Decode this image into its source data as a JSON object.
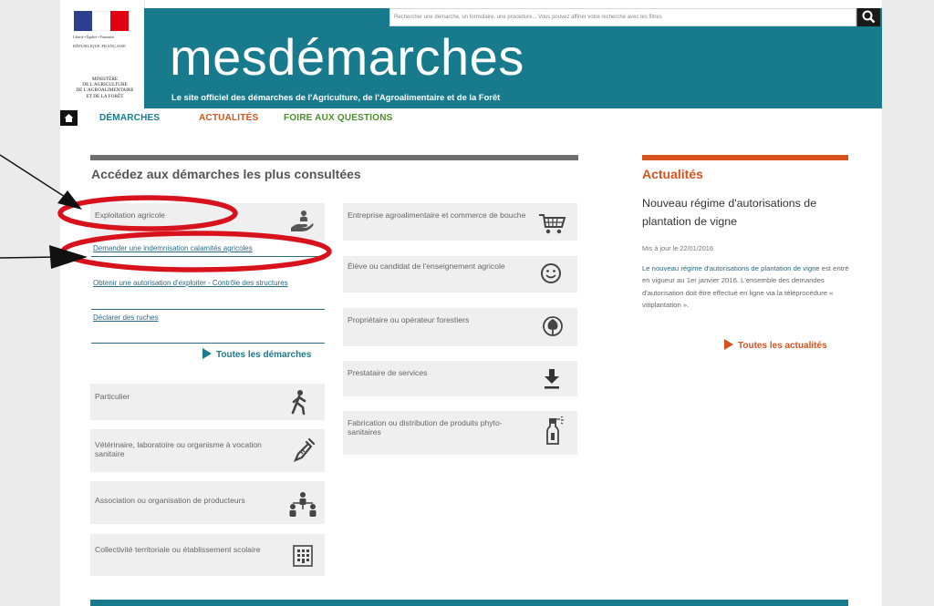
{
  "header": {
    "motto": "Liberté • Égalité • Fraternité",
    "republic": "RÉPUBLIQUE FRANÇAISE",
    "ministry_lines": [
      "MINISTÈRE",
      "DE L'AGRICULTURE",
      "DE L'AGROALIMENTAIRE",
      "ET DE LA FORÊT"
    ],
    "search_placeholder": "Rechercher une démarche, un formulaire, une procédure... Vous pouvez affiner votre recherche avec les filtres",
    "site_title": "mesdémarches",
    "site_subtitle": "Le site officiel des démarches de l'Agriculture, de l'Agroalimentaire et de la Forêt",
    "banner_color": "#187b8d"
  },
  "nav": {
    "demarches": "DÉMARCHES",
    "actualites": "ACTUALITÉS",
    "faq": "FOIRE AUX QUESTIONS"
  },
  "main": {
    "section_title": "Accédez aux démarches les plus consultées",
    "exploitation": "Exploitation agricole",
    "sublinks": [
      "Demander une indemnisation calamités agricoles",
      "Obtenir une autorisation d'exploiter - Contrôle des structures",
      "Déclarer des ruches"
    ],
    "all_demarches": "Toutes les démarches",
    "particulier": "Particulier",
    "veterinaire": "Vétérinaire, laboratoire ou organisme à vocation sanitaire",
    "association": "Association ou organisation de producteurs",
    "collectivite": "Collectivité territoriale ou établissement scolaire",
    "entreprise": "Entreprise agroalimentaire et commerce de bouche",
    "eleve": "Élève ou candidat de l'enseignement agricole",
    "proprietaire": "Propriétaire ou opérateur forestiers",
    "prestataire": "Prestataire de services",
    "fabrication": "Fabrication ou distribution de produits phyto-sanitaires"
  },
  "news": {
    "title": "Actualités",
    "headline": "Nouveau régime d'autorisations de plantation de vigne",
    "date": "Mis à jour le 22/01/2016",
    "body_link": "Le nouveau régime d'autorisations de plantation de vigne",
    "body_rest": " est entré en vigueur au 1er janvier 2016. L'ensemble des demandes d'autorisation doit être effectué en ligne via la téléprocédure « vitiplantation ».",
    "all_news": "Toutes les actualités"
  },
  "colors": {
    "teal": "#187b8d",
    "orange": "#d8531c",
    "green": "#4a8d2e",
    "annotation_red": "#d8121c"
  }
}
